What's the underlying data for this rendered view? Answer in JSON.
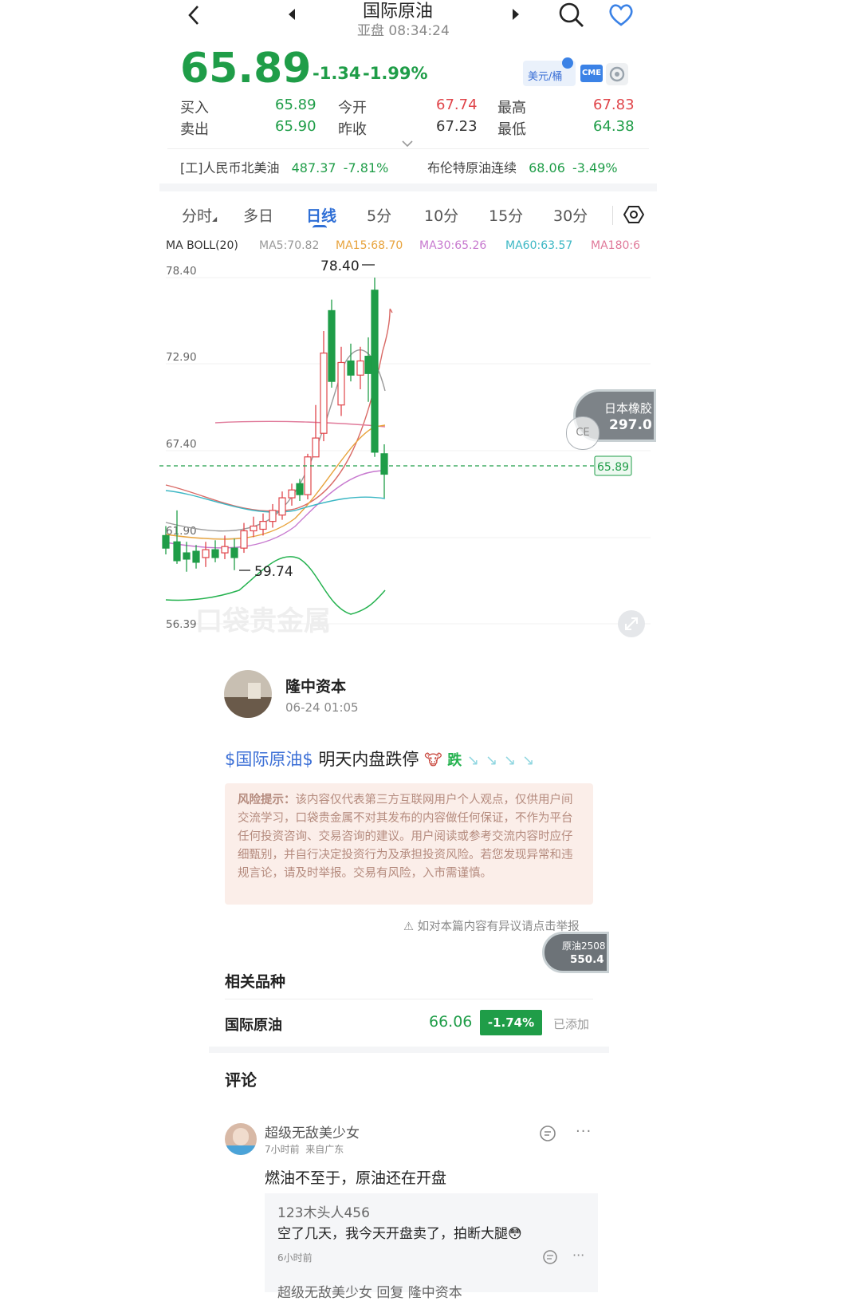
{
  "header": {
    "title": "国际原油",
    "subtitle": "亚盘 08:34:24"
  },
  "quote": {
    "price": "65.89",
    "change": "-1.34",
    "change_pct": "-1.99%",
    "unit_badge": "美元/桶",
    "exchange_badge": "CME",
    "bid_label": "买入",
    "bid": "65.89",
    "ask_label": "卖出",
    "ask": "65.90",
    "open_label": "今开",
    "open": "67.74",
    "prev_close_label": "昨收",
    "prev_close": "67.23",
    "high_label": "最高",
    "high": "67.83",
    "low_label": "最低",
    "low": "64.38"
  },
  "related_ticker": {
    "left_name": "[工]人民币北美油",
    "left_price": "487.37",
    "left_pct": "-7.81%",
    "right_name": "布伦特原油连续",
    "right_price": "68.06",
    "right_pct": "-3.49%"
  },
  "tabs": [
    "分时",
    "多日",
    "日线",
    "5分",
    "10分",
    "15分",
    "30分"
  ],
  "active_tab": "日线",
  "indicators": {
    "main": "MA BOLL(20)",
    "ma5": "MA5:70.82",
    "ma15": "MA15:68.70",
    "ma30": "MA30:65.26",
    "ma60": "MA60:63.57",
    "ma180": "MA180:6",
    "colors": {
      "ma5": "#999999",
      "ma15": "#e8a33c",
      "ma30": "#c779cf",
      "ma60": "#3cb7c4",
      "ma180": "#e07a9a"
    }
  },
  "chart": {
    "y_labels": [
      "78.40",
      "72.90",
      "67.40",
      "61.90",
      "56.39"
    ],
    "max_label": "78.40",
    "min_label": "59.74",
    "current_price_tag": "65.89",
    "floating_widget": {
      "name": "日本橡胶",
      "value": "297.0"
    },
    "watermark": "口袋贵金属"
  },
  "post": {
    "author": "隆中资本",
    "time": "06-24 01:05",
    "tag": "$国际原油$",
    "text": "明天内盘跌停",
    "drop_word": "跌",
    "risk_title": "风险提示：",
    "risk_text": "该内容仅代表第三方互联网用户个人观点，仅供用户间交流学习，口袋贵金属不对其发布的内容做任何保证，不作为平台任何投资咨询、交易咨询的建议。用户阅读或参考交流内容时应仔细甄别，并自行决定投资行为及承担投资风险。若您发现异常和违规言论，请及时举报。交易有风险，入市需谨慎。",
    "report": "⚠ 如对本篇内容有异议请点击举报"
  },
  "floating_widget2": {
    "name": "原油2508",
    "value": "550.4"
  },
  "related": {
    "title": "相关品种",
    "item": {
      "name": "国际原油",
      "price": "66.06",
      "pct": "-1.74%",
      "status": "已添加"
    }
  },
  "comments": {
    "title": "评论",
    "items": [
      {
        "user": "超级无敌美少女",
        "meta": "7小时前  来自广东",
        "text": "燃油不至于，原油还在开盘",
        "reply_user": "123木头人456",
        "reply_text": "空了几天，我今天开盘卖了，拍断大腿😳",
        "reply_time": "6小时前",
        "next_line": "超级无敌美少女 回复 隆中资本"
      }
    ]
  }
}
